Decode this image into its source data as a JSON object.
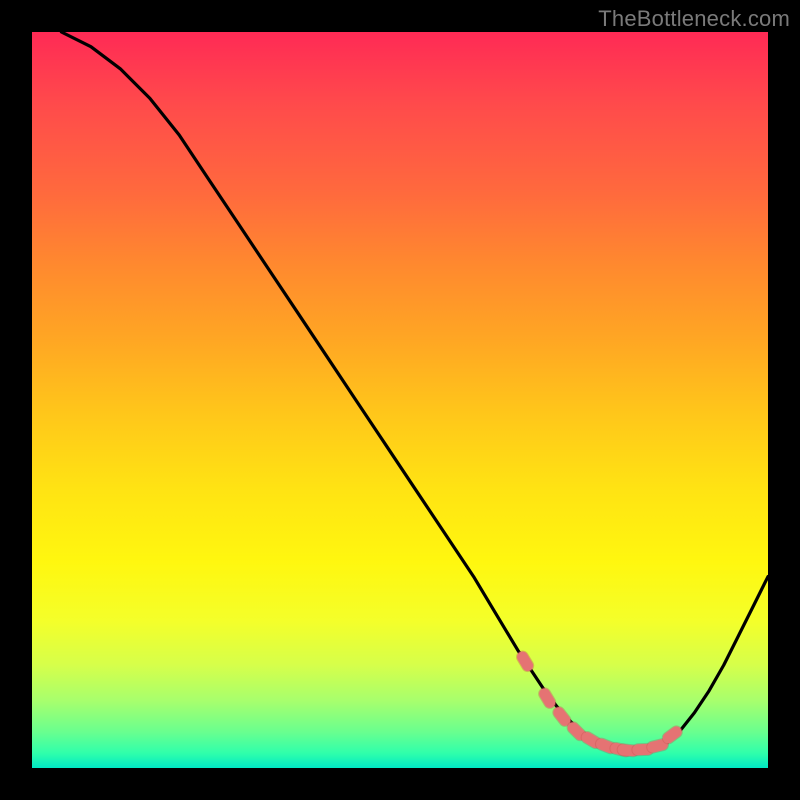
{
  "watermark": "TheBottleneck.com",
  "colors": {
    "curve": "#000000",
    "marker_fill": "#e57373",
    "marker_stroke": "#c94f4f"
  },
  "chart_data": {
    "type": "line",
    "title": "",
    "xlabel": "",
    "ylabel": "",
    "xlim": [
      0,
      100
    ],
    "ylim": [
      0,
      100
    ],
    "grid": false,
    "legend": false,
    "series": [
      {
        "name": "curve",
        "x": [
          4,
          8,
          12,
          16,
          20,
          24,
          28,
          32,
          36,
          40,
          44,
          48,
          52,
          56,
          60,
          63,
          66,
          68,
          70,
          72,
          74,
          76,
          78,
          80,
          82,
          84,
          86,
          88,
          90,
          92,
          94,
          96,
          98,
          100
        ],
        "y": [
          100,
          98,
          95,
          91,
          86,
          80,
          74,
          68,
          62,
          56,
          50,
          44,
          38,
          32,
          26,
          21,
          16,
          13,
          10,
          7.5,
          5.5,
          4,
          3,
          2.3,
          2,
          2.3,
          3.2,
          5,
          7.5,
          10.5,
          14,
          18,
          22,
          26
        ]
      }
    ],
    "markers": {
      "name": "highlight-dots",
      "x": [
        67,
        70,
        72,
        74,
        76,
        78,
        80,
        81,
        83,
        85,
        87
      ],
      "y": [
        14.5,
        9.5,
        7,
        5,
        3.8,
        3,
        2.5,
        2.4,
        2.5,
        3,
        4.5
      ]
    }
  }
}
